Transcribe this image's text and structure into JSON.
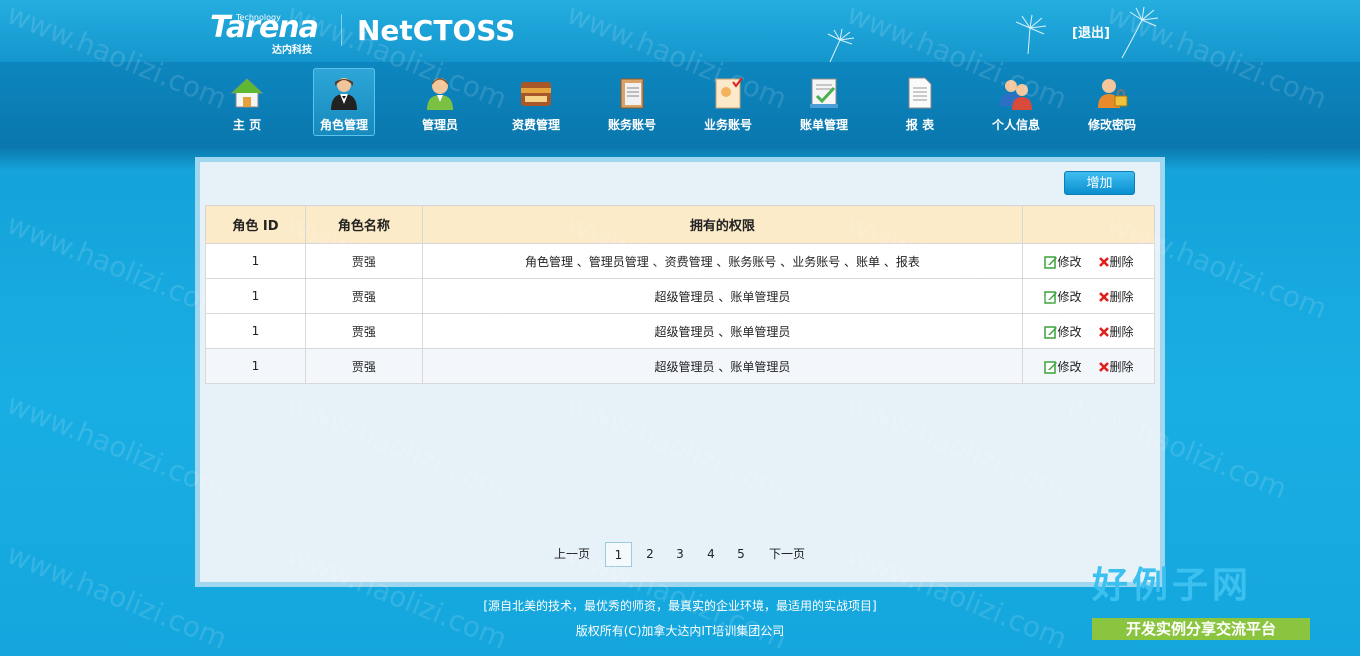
{
  "header": {
    "brand": "Tarena",
    "brand_tag": "Technology",
    "brand_cn": "达内科技",
    "product": "NetCTOSS",
    "logout": "[退出]"
  },
  "nav": {
    "items": [
      {
        "label": "主  页",
        "icon": "home-icon"
      },
      {
        "label": "角色管理",
        "icon": "role-icon",
        "active": true
      },
      {
        "label": "管理员",
        "icon": "admin-icon"
      },
      {
        "label": "资费管理",
        "icon": "fee-icon"
      },
      {
        "label": "账务账号",
        "icon": "account-icon"
      },
      {
        "label": "业务账号",
        "icon": "service-icon"
      },
      {
        "label": "账单管理",
        "icon": "bill-icon"
      },
      {
        "label": "报  表",
        "icon": "report-icon"
      },
      {
        "label": "个人信息",
        "icon": "user-info-icon"
      },
      {
        "label": "修改密码",
        "icon": "password-icon"
      }
    ]
  },
  "main": {
    "add_label": "增加",
    "columns": [
      "角色 ID",
      "角色名称",
      "拥有的权限",
      ""
    ],
    "rows": [
      {
        "id": "1",
        "name": "贾强",
        "perms": "角色管理 、管理员管理 、资费管理 、账务账号 、业务账号 、账单 、报表"
      },
      {
        "id": "1",
        "name": "贾强",
        "perms": "超级管理员 、账单管理员"
      },
      {
        "id": "1",
        "name": "贾强",
        "perms": "超级管理员 、账单管理员"
      },
      {
        "id": "1",
        "name": "贾强",
        "perms": "超级管理员 、账单管理员"
      }
    ],
    "edit_label": "修改",
    "delete_label": "删除"
  },
  "pager": {
    "prev": "上一页",
    "pages": [
      "1",
      "2",
      "3",
      "4",
      "5"
    ],
    "current": "1",
    "next": "下一页"
  },
  "footer": {
    "slogan": "[源自北美的技术，最优秀的师资，最真实的企业环境，最适用的实战项目]",
    "copyright": "版权所有(C)加拿大达内IT培训集团公司"
  },
  "watermark": {
    "text": "www.haolizi.com",
    "corner_title": "好例子网",
    "corner_sub": "开发实例分享交流平台"
  },
  "colors": {
    "header_bg": "#1a9fd4",
    "table_header": "#fcebc8",
    "add_button": "#0a8fd0",
    "delete_red": "#e0201b",
    "edit_green": "#3aa33a"
  }
}
